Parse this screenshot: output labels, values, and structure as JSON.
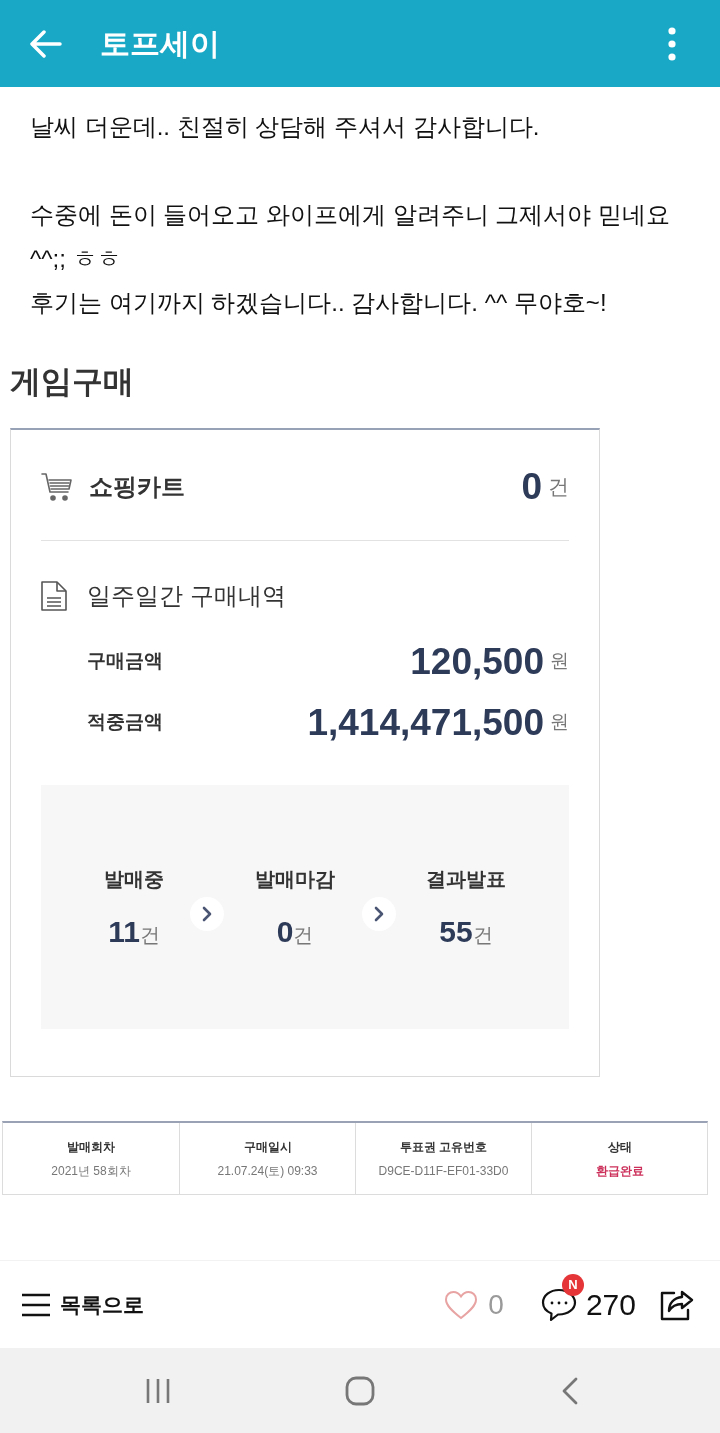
{
  "app_bar": {
    "title": "토프세이"
  },
  "post": {
    "paragraphs": [
      "날씨 더운데.. 친절히 상담해 주셔서 감사합니다.",
      "수중에 돈이 들어오고 와이프에게 알려주니 그제서야 믿네요\n^^;; ㅎㅎ\n후기는 여기까지 하겠습니다.. 감사합니다. ^^ 무야호~!"
    ]
  },
  "purchase": {
    "heading": "게임구매",
    "cart": {
      "label": "쇼핑카트",
      "count": "0",
      "unit": "건"
    },
    "history": {
      "title": "일주일간 구매내역",
      "amounts": [
        {
          "label": "구매금액",
          "value": "120,500",
          "unit": "원"
        },
        {
          "label": "적중금액",
          "value": "1,414,471,500",
          "unit": "원"
        }
      ],
      "stages": [
        {
          "label": "발매중",
          "count": "11",
          "unit": "건"
        },
        {
          "label": "발매마감",
          "count": "0",
          "unit": "건"
        },
        {
          "label": "결과발표",
          "count": "55",
          "unit": "건"
        }
      ]
    }
  },
  "ticket_table": {
    "columns": [
      {
        "header": "발매회차",
        "value": "2021년 58회차",
        "kind": "plain"
      },
      {
        "header": "구매일시",
        "value": "21.07.24(토) 09:33",
        "kind": "plain"
      },
      {
        "header": "투표권 고유번호",
        "value": "D9CE-D11F-EF01-33D0",
        "kind": "plain"
      },
      {
        "header": "상태",
        "value": "환급완료",
        "kind": "status"
      }
    ]
  },
  "bottom_bar": {
    "list_label": "목록으로",
    "liked": false,
    "likes": "0",
    "comment_badge": "N",
    "comments": "270"
  }
}
